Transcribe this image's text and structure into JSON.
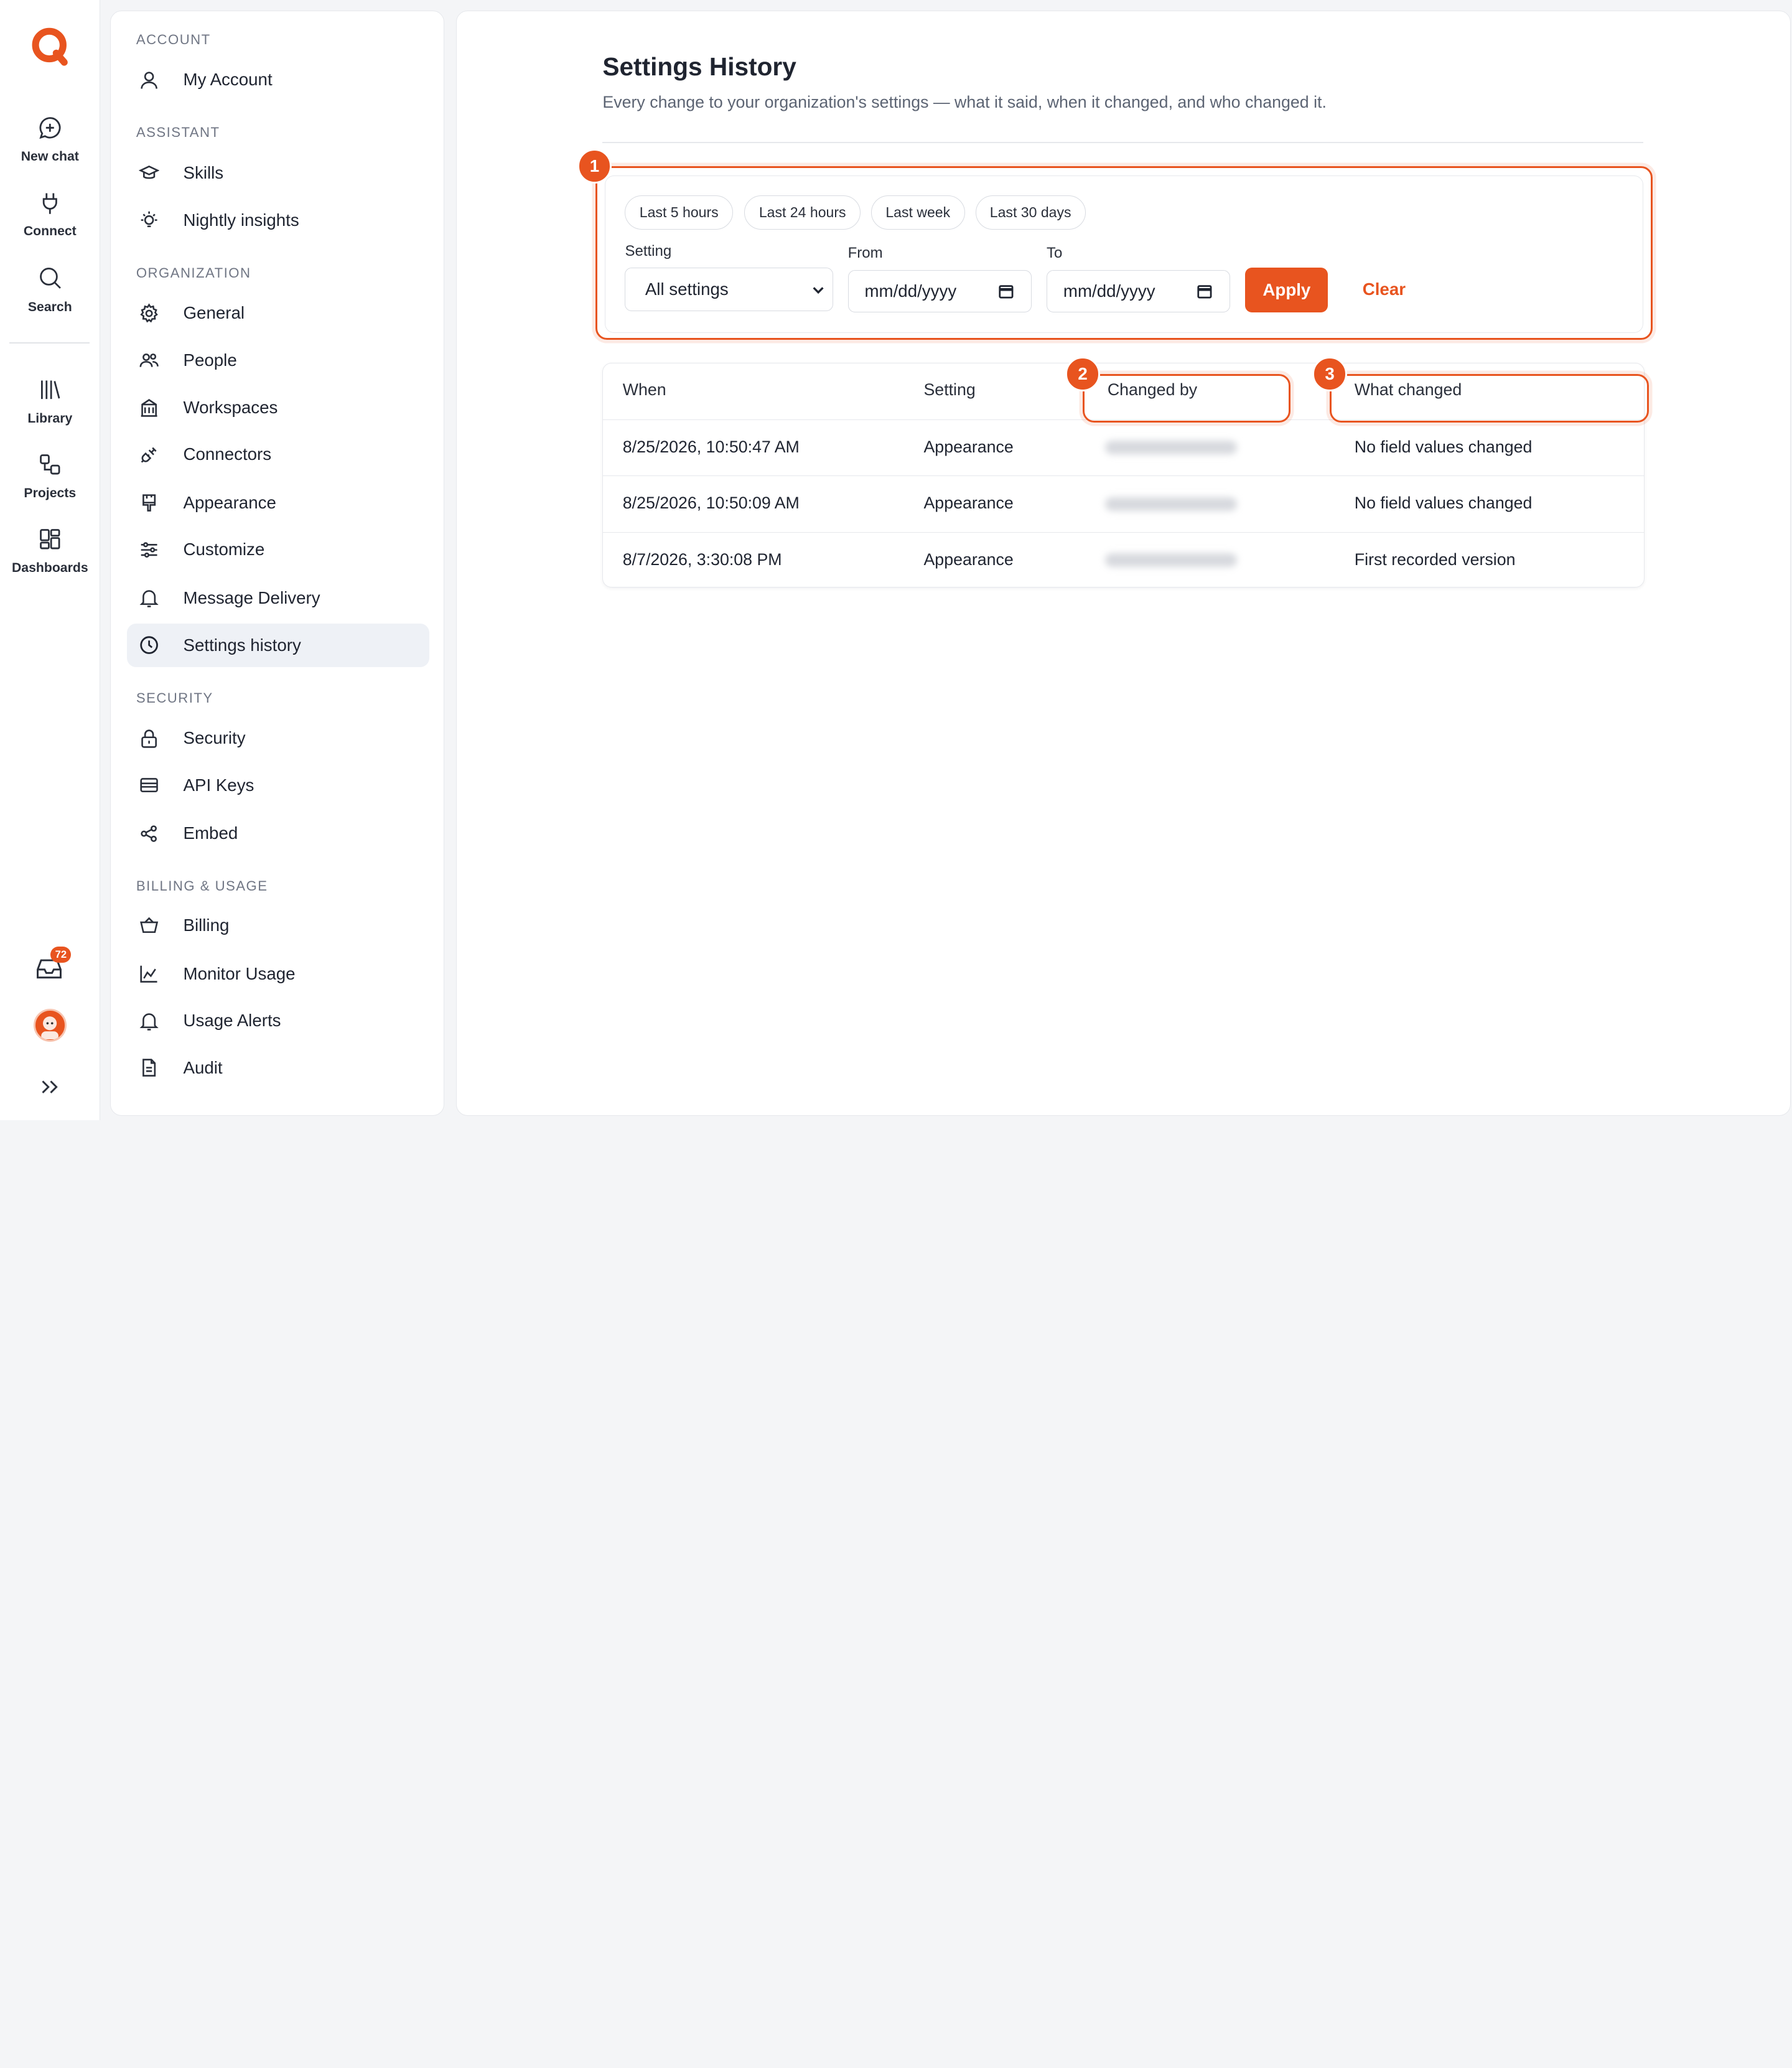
{
  "rail": {
    "items": [
      {
        "label": "New chat",
        "icon": "new-chat-icon"
      },
      {
        "label": "Connect",
        "icon": "plug-icon"
      },
      {
        "label": "Search",
        "icon": "search-icon"
      },
      {
        "label": "Library",
        "icon": "library-icon"
      },
      {
        "label": "Projects",
        "icon": "projects-icon"
      },
      {
        "label": "Dashboards",
        "icon": "dashboards-icon"
      }
    ],
    "inbox_badge": "72",
    "accent": "#e8541f"
  },
  "sidebar": {
    "sections": [
      {
        "header": "ACCOUNT",
        "items": [
          {
            "label": "My Account",
            "icon": "user-icon"
          }
        ]
      },
      {
        "header": "ASSISTANT",
        "items": [
          {
            "label": "Skills",
            "icon": "graduation-cap-icon"
          },
          {
            "label": "Nightly insights",
            "icon": "lightbulb-icon"
          }
        ]
      },
      {
        "header": "ORGANIZATION",
        "items": [
          {
            "label": "General",
            "icon": "gear-icon"
          },
          {
            "label": "People",
            "icon": "people-icon"
          },
          {
            "label": "Workspaces",
            "icon": "building-icon"
          },
          {
            "label": "Connectors",
            "icon": "connector-icon"
          },
          {
            "label": "Appearance",
            "icon": "paintbrush-icon"
          },
          {
            "label": "Customize",
            "icon": "sliders-icon"
          },
          {
            "label": "Message Delivery",
            "icon": "bell-icon"
          },
          {
            "label": "Settings history",
            "icon": "clock-icon",
            "active": true
          }
        ]
      },
      {
        "header": "SECURITY",
        "items": [
          {
            "label": "Security",
            "icon": "lock-icon"
          },
          {
            "label": "API Keys",
            "icon": "card-icon"
          },
          {
            "label": "Embed",
            "icon": "share-icon"
          }
        ]
      },
      {
        "header": "BILLING & USAGE",
        "items": [
          {
            "label": "Billing",
            "icon": "basket-icon"
          },
          {
            "label": "Monitor Usage",
            "icon": "chart-icon"
          },
          {
            "label": "Usage Alerts",
            "icon": "bell-icon"
          },
          {
            "label": "Audit",
            "icon": "document-icon"
          }
        ]
      }
    ]
  },
  "main": {
    "title": "Settings History",
    "subtitle": "Every change to your organization's settings — what it said, when it changed, and who changed it.",
    "annotations": [
      "1",
      "2",
      "3"
    ],
    "filters": {
      "chips": [
        "Last 5 hours",
        "Last 24 hours",
        "Last week",
        "Last 30 days"
      ],
      "setting_label": "Setting",
      "setting_value": "All settings",
      "from_label": "From",
      "from_placeholder": "mm/dd/yyyy",
      "to_label": "To",
      "to_placeholder": "mm/dd/yyyy",
      "apply_label": "Apply",
      "clear_label": "Clear"
    },
    "table": {
      "headers": [
        "When",
        "Setting",
        "Changed by",
        "What changed"
      ],
      "rows": [
        {
          "when": "8/25/2026, 10:50:47 AM",
          "setting": "Appearance",
          "what": "No field values changed"
        },
        {
          "when": "8/25/2026, 10:50:09 AM",
          "setting": "Appearance",
          "what": "No field values changed"
        },
        {
          "when": "8/7/2026, 3:30:08 PM",
          "setting": "Appearance",
          "what": "First recorded version"
        }
      ]
    }
  }
}
